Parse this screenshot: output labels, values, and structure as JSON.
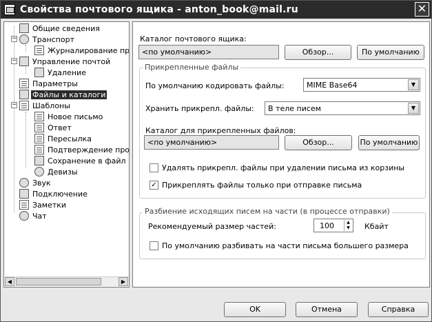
{
  "window": {
    "title": "Свойства почтового ящика - anton_book@mail.ru"
  },
  "tree": {
    "items": [
      {
        "label": "Общие сведения"
      },
      {
        "label": "Транспорт"
      },
      {
        "label": "Журналирование прот"
      },
      {
        "label": "Управление почтой"
      },
      {
        "label": "Удаление"
      },
      {
        "label": "Параметры"
      },
      {
        "label": "Файлы и каталоги"
      },
      {
        "label": "Шаблоны"
      },
      {
        "label": "Новое письмо"
      },
      {
        "label": "Ответ"
      },
      {
        "label": "Пересылка"
      },
      {
        "label": "Подтверждение прочт"
      },
      {
        "label": "Сохранение в файл"
      },
      {
        "label": "Девизы"
      },
      {
        "label": "Звук"
      },
      {
        "label": "Подключение"
      },
      {
        "label": "Заметки"
      },
      {
        "label": "Чат"
      }
    ]
  },
  "mailbox": {
    "label": "Каталог почтового ящика:",
    "value": "<по умолчанию>",
    "browse": "Обзор...",
    "default": "По умолчанию"
  },
  "attachments": {
    "group_title": "Прикрепленные файлы",
    "encoding_label": "По умолчанию кодировать файлы:",
    "encoding_value": "MIME Base64",
    "storage_label": "Хранить прикрепл. файлы:",
    "storage_value": "В теле писем",
    "dir_label": "Каталог для прикрепленных файлов:",
    "dir_value": "<по умолчанию>",
    "browse": "Обзор...",
    "default": "По умолчанию",
    "delete_label": "Удалять прикрепл. файлы при удалении письма из корзины",
    "delete_checked": false,
    "attach_label": "Прикреплять файлы только при отправке письма",
    "attach_checked": true
  },
  "split": {
    "group_title": "Разбиение исходящих писем на части (в процессе отправки)",
    "size_label": "Рекомендуемый размер частей:",
    "size_value": "100",
    "unit": "Кбайт",
    "split_label": "По умолчанию разбивать на части письма большего размера",
    "split_checked": false
  },
  "buttons": {
    "ok": "OK",
    "cancel": "Отмена",
    "help": "Справка"
  },
  "check_mark": "✓"
}
